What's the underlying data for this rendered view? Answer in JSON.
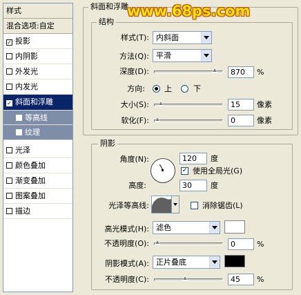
{
  "left_panel": {
    "items": [
      {
        "label": "样式",
        "kind": "head"
      },
      {
        "label": "混合选项:自定",
        "kind": "head"
      },
      {
        "label": "投影",
        "checked": true
      },
      {
        "label": "内阴影",
        "checked": false
      },
      {
        "label": "外发光",
        "checked": false
      },
      {
        "label": "内发光",
        "checked": false
      },
      {
        "label": "斜面和浮雕",
        "checked": true,
        "selected": true
      },
      {
        "label": "等高线",
        "checked": false,
        "sub": true
      },
      {
        "label": "纹理",
        "checked": false,
        "sub": true
      },
      {
        "label": "光泽",
        "checked": false
      },
      {
        "label": "颜色叠加",
        "checked": false
      },
      {
        "label": "渐变叠加",
        "checked": false
      },
      {
        "label": "图案叠加",
        "checked": false
      },
      {
        "label": "描边",
        "checked": false
      }
    ]
  },
  "watermark": "www.68ps.com",
  "bevel": {
    "title": "斜面和浮雕",
    "structure_title": "结构",
    "style_label": "样式(T):",
    "style_value": "内斜面",
    "technique_label": "方法(Q):",
    "technique_value": "平滑",
    "depth_label": "深度(D):",
    "depth_value": "870",
    "depth_unit": "%",
    "depth_fraction": 0.93,
    "direction_label": "方向:",
    "direction_up": "上",
    "direction_down": "下",
    "size_label": "大小(S):",
    "size_value": "15",
    "size_unit": "像素",
    "size_fraction": 0.06,
    "soften_label": "软化(F):",
    "soften_value": "0",
    "soften_unit": "像素",
    "soften_fraction": 0.0
  },
  "shading": {
    "title": "阴影",
    "angle_label": "角度(N):",
    "angle_value": "120",
    "angle_unit": "度",
    "global_light_label": "使用全局光(G)",
    "global_light_checked": true,
    "altitude_label": "高度:",
    "altitude_value": "30",
    "altitude_unit": "度",
    "gloss_contour_label": "光泽等高线:",
    "anti_alias_label": "消除锯齿(L)",
    "anti_alias_checked": false,
    "highlight_mode_label": "高光模式(H):",
    "highlight_mode_value": "滤色",
    "highlight_color": "#ffffff",
    "highlight_opacity_label": "不透明度(O):",
    "highlight_opacity_value": "0",
    "highlight_opacity_unit": "%",
    "highlight_opacity_fraction": 0.0,
    "shadow_mode_label": "阴影模式(A):",
    "shadow_mode_value": "正片叠底",
    "shadow_color": "#000000",
    "shadow_opacity_label": "不透明度(C):",
    "shadow_opacity_value": "45",
    "shadow_opacity_unit": "%",
    "shadow_opacity_fraction": 0.45
  },
  "colors": {
    "selected_bg": "#0a246a",
    "sub_bg": "#7f8ea8",
    "dialog_bg": "#ece9d8"
  }
}
